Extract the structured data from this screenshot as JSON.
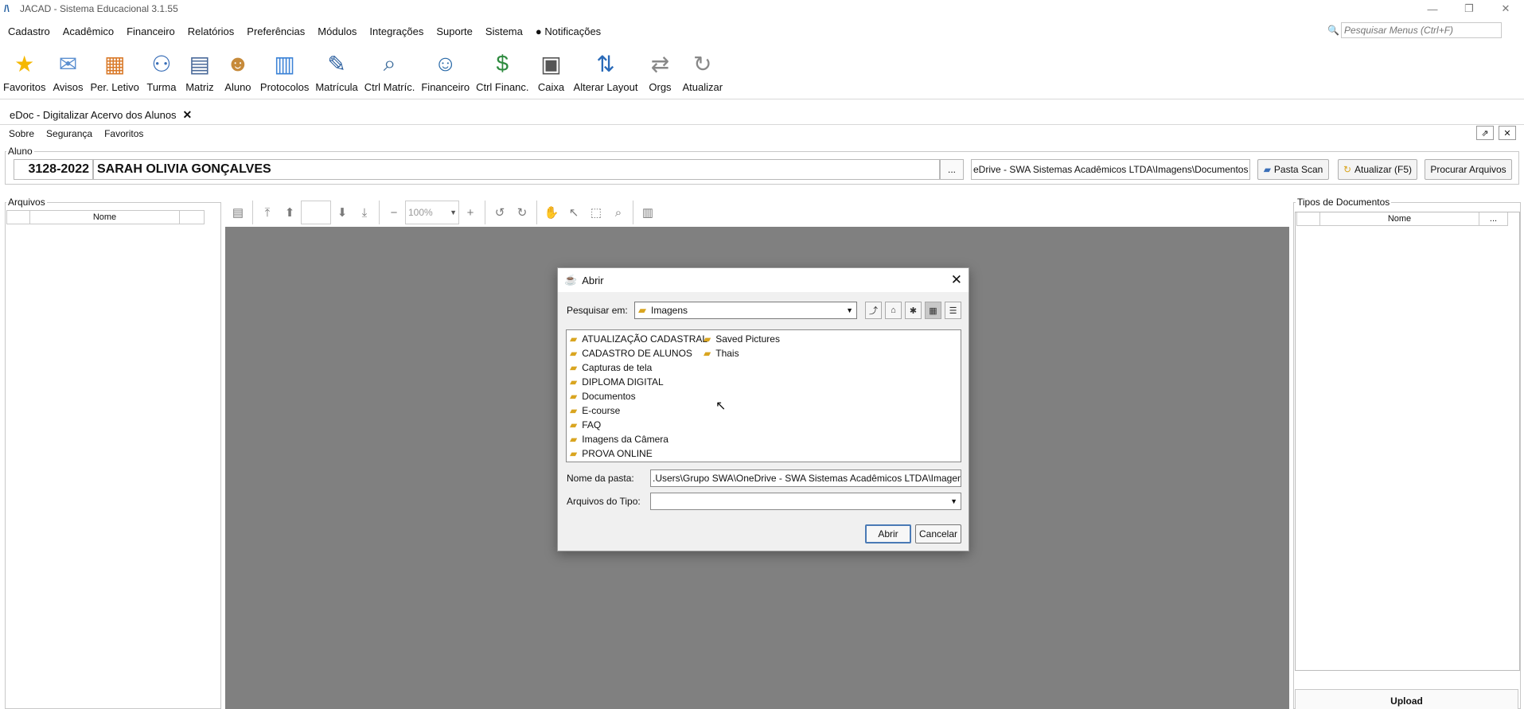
{
  "window": {
    "title": "JACAD - Sistema Educacional 3.1.55",
    "controls": [
      "—",
      "❐",
      "✕"
    ]
  },
  "menu": {
    "items": [
      "Cadastro",
      "Acadêmico",
      "Financeiro",
      "Relatórios",
      "Preferências",
      "Módulos",
      "Integrações",
      "Suporte",
      "Sistema"
    ],
    "notifications_label": "Notificações",
    "search_placeholder": "Pesquisar Menus (Ctrl+F)"
  },
  "toolbar": {
    "items": [
      {
        "label": "Favoritos",
        "icon": "star-icon",
        "color": "#f5b800"
      },
      {
        "label": "Avisos",
        "icon": "envelope-icon",
        "color": "#5b8fd0"
      },
      {
        "label": "Per. Letivo",
        "icon": "calendar-icon",
        "color": "#d97a2a"
      },
      {
        "label": "Turma",
        "icon": "group-icon",
        "color": "#3a6fb8"
      },
      {
        "label": "Matriz",
        "icon": "document-icon",
        "color": "#4a6a9a"
      },
      {
        "label": "Aluno",
        "icon": "student-icon",
        "color": "#c68a3a"
      },
      {
        "label": "Protocolos",
        "icon": "protocol-icon",
        "color": "#3b82d6"
      },
      {
        "label": "Matrícula",
        "icon": "enroll-icon",
        "color": "#2a5e9e"
      },
      {
        "label": "Ctrl Matríc.",
        "icon": "search-doc-icon",
        "color": "#3a6a9a"
      },
      {
        "label": "Financeiro",
        "icon": "finance-person-icon",
        "color": "#2a6aa8"
      },
      {
        "label": "Ctrl Financ.",
        "icon": "money-hand-icon",
        "color": "#2d8a3e"
      },
      {
        "label": "Caixa",
        "icon": "cash-register-icon",
        "color": "#555555"
      },
      {
        "label": "Alterar Layout",
        "icon": "layout-swap-icon",
        "color": "#2a6ab8"
      },
      {
        "label": "Orgs",
        "icon": "arrows-swap-icon",
        "color": "#888888"
      },
      {
        "label": "Atualizar",
        "icon": "refresh-icon",
        "color": "#888888"
      }
    ]
  },
  "tab": {
    "label": "eDoc - Digitalizar Acervo dos Alunos",
    "close": "✕"
  },
  "submenu": [
    "Sobre",
    "Segurança",
    "Favoritos"
  ],
  "aluno": {
    "group_label": "Aluno",
    "code": "3128-2022",
    "name": "SARAH OLIVIA GONÇALVES",
    "dots": "...",
    "path": "eDrive - SWA Sistemas Acadêmicos LTDA\\Imagens\\Documentos",
    "btn_pasta_scan": "Pasta Scan",
    "btn_atualizar": "Atualizar (F5)",
    "btn_procurar": "Procurar Arquivos"
  },
  "arquivos": {
    "group_label": "Arquivos",
    "col_nome": "Nome"
  },
  "viewer": {
    "zoom": "100%"
  },
  "tipos": {
    "group_label": "Tipos de Documentos",
    "col_nome": "Nome",
    "col_more": "...",
    "upload": "Upload"
  },
  "dialog": {
    "title": "Abrir",
    "look_in_label": "Pesquisar em:",
    "look_in_value": "Imagens",
    "folders_col1": [
      "ATUALIZAÇÃO CADASTRAL",
      "CADASTRO DE ALUNOS",
      "Capturas de tela",
      "DIPLOMA DIGITAL",
      "Documentos",
      "E-course",
      "FAQ",
      "Imagens da Câmera",
      "PROVA ONLINE"
    ],
    "folders_col2": [
      "Saved Pictures",
      "Thais"
    ],
    "folder_name_label": "Nome da pasta:",
    "folder_name_value": ".Users\\Grupo SWA\\OneDrive - SWA Sistemas Acadêmicos LTDA\\Imagens",
    "file_type_label": "Arquivos do Tipo:",
    "file_type_value": "",
    "open_btn": "Abrir",
    "cancel_btn": "Cancelar"
  }
}
